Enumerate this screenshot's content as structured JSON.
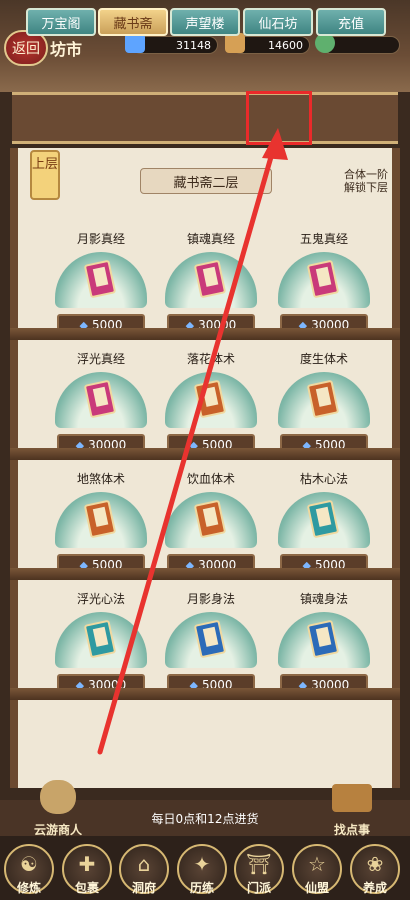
{
  "header": {
    "back_label": "返回",
    "title": "坊市",
    "resources": [
      {
        "name": "spirit-stone",
        "value": "31148"
      },
      {
        "name": "gold",
        "value": "14600"
      },
      {
        "name": "jade",
        "value": ""
      }
    ]
  },
  "tabs": [
    {
      "label": "万宝阁"
    },
    {
      "label": "藏书斋",
      "active": true
    },
    {
      "label": "声望楼"
    },
    {
      "label": "仙石坊"
    },
    {
      "label": "充值"
    }
  ],
  "floor": {
    "tag": "上层",
    "name": "藏书斋二层",
    "hint_line1": "合体一阶",
    "hint_line2": "解锁下层"
  },
  "items": [
    {
      "name": "月影真经",
      "price": "5000",
      "color": "#c93a7a"
    },
    {
      "name": "镇魂真经",
      "price": "30000",
      "color": "#c93a7a"
    },
    {
      "name": "五鬼真经",
      "price": "30000",
      "color": "#c93a7a"
    },
    {
      "name": "浮光真经",
      "price": "30000",
      "color": "#c93a7a"
    },
    {
      "name": "落花体术",
      "price": "5000",
      "color": "#c8612a"
    },
    {
      "name": "度生体术",
      "price": "5000",
      "color": "#c8612a"
    },
    {
      "name": "地煞体术",
      "price": "5000",
      "color": "#c8612a"
    },
    {
      "name": "饮血体术",
      "price": "30000",
      "color": "#c8612a"
    },
    {
      "name": "枯木心法",
      "price": "5000",
      "color": "#2f9aa1"
    },
    {
      "name": "浮光心法",
      "price": "30000",
      "color": "#2f9aa1"
    },
    {
      "name": "月影身法",
      "price": "5000",
      "color": "#2c6bb8"
    },
    {
      "name": "镇魂身法",
      "price": "30000",
      "color": "#2c6bb8"
    }
  ],
  "footer": {
    "refresh_text": "每日0点和12点进货",
    "left_label": "云游商人",
    "right_label": "找点事"
  },
  "nav": [
    {
      "label": "修炼"
    },
    {
      "label": "包裹"
    },
    {
      "label": "洞府"
    },
    {
      "label": "历练"
    },
    {
      "label": "门派"
    },
    {
      "label": "仙盟"
    },
    {
      "label": "养成"
    }
  ],
  "colors": {
    "highlight": "#ea2a2a",
    "arrow": "#e8332f"
  }
}
